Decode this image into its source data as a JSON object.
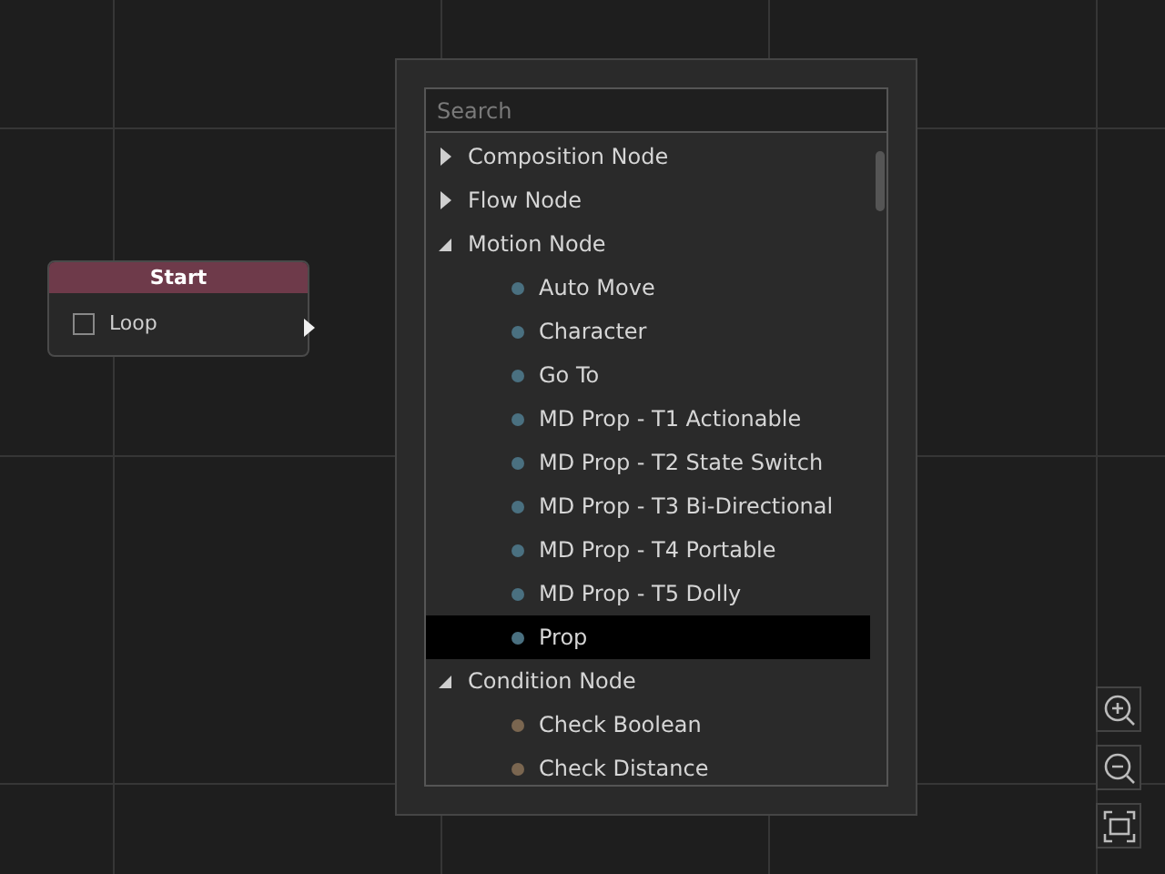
{
  "node": {
    "title": "Start",
    "checkbox": {
      "label": "Loop",
      "checked": false
    }
  },
  "menu": {
    "search": {
      "placeholder": "Search"
    },
    "categories": [
      {
        "label": "Composition Node",
        "expanded": false
      },
      {
        "label": "Flow Node",
        "expanded": false
      },
      {
        "label": "Motion Node",
        "expanded": true,
        "children": [
          {
            "label": "Auto Move",
            "color": "#4a7080",
            "selected": false
          },
          {
            "label": "Character",
            "color": "#4a7080",
            "selected": false
          },
          {
            "label": "Go To",
            "color": "#4a7080",
            "selected": false
          },
          {
            "label": "MD Prop - T1 Actionable",
            "color": "#4a7080",
            "selected": false
          },
          {
            "label": "MD Prop - T2 State Switch",
            "color": "#4a7080",
            "selected": false
          },
          {
            "label": "MD Prop - T3 Bi-Directional",
            "color": "#4a7080",
            "selected": false
          },
          {
            "label": "MD Prop - T4 Portable",
            "color": "#4a7080",
            "selected": false
          },
          {
            "label": "MD Prop - T5 Dolly",
            "color": "#4a7080",
            "selected": false
          },
          {
            "label": "Prop",
            "color": "#4a7080",
            "selected": true
          }
        ]
      },
      {
        "label": "Condition Node",
        "expanded": true,
        "children": [
          {
            "label": "Check Boolean",
            "color": "#7a6650",
            "selected": false
          },
          {
            "label": "Check Distance",
            "color": "#7a6650",
            "selected": false
          }
        ]
      }
    ]
  }
}
